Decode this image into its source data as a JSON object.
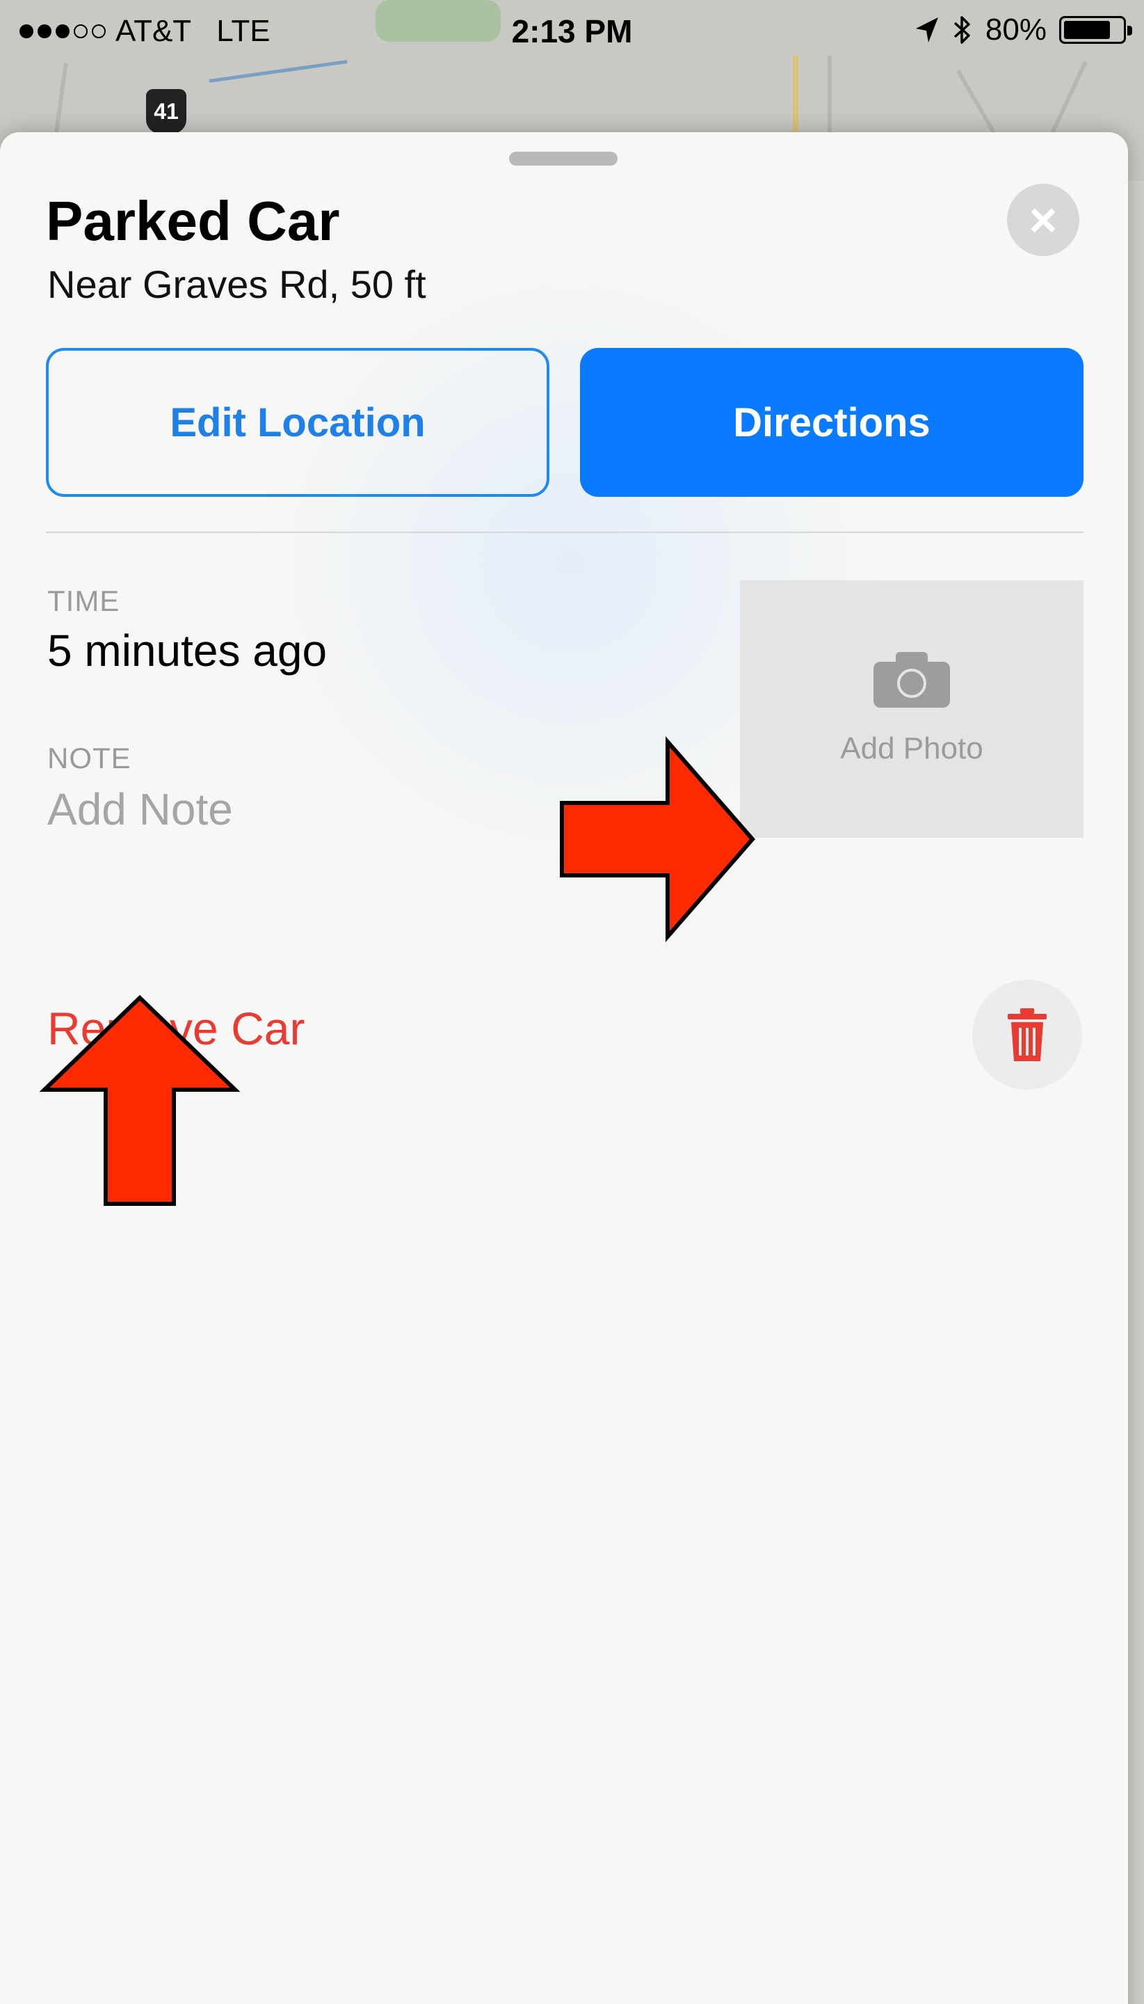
{
  "status_bar": {
    "carrier": "AT&T",
    "network": "LTE",
    "time": "2:13 PM",
    "battery_percent": "80%",
    "battery_level": 0.8,
    "signal_bars_filled": 3,
    "signal_bars_total": 5
  },
  "map": {
    "route_shield": "41"
  },
  "sheet": {
    "title": "Parked Car",
    "subtitle": "Near Graves Rd, 50 ft",
    "edit_location_label": "Edit Location",
    "directions_label": "Directions",
    "time_label": "TIME",
    "time_value": "5 minutes ago",
    "note_label": "NOTE",
    "note_placeholder": "Add Note",
    "add_photo_label": "Add Photo",
    "remove_car_label": "Remove Car"
  },
  "colors": {
    "accent": "#0a7aff",
    "destructive": "#ea3a32",
    "annotation_arrow": "#ff2a00"
  },
  "icons": {
    "close": "close-icon",
    "camera": "camera-icon",
    "trash": "trash-icon",
    "location": "location-arrow-icon",
    "bluetooth": "bluetooth-icon",
    "battery": "battery-icon"
  }
}
